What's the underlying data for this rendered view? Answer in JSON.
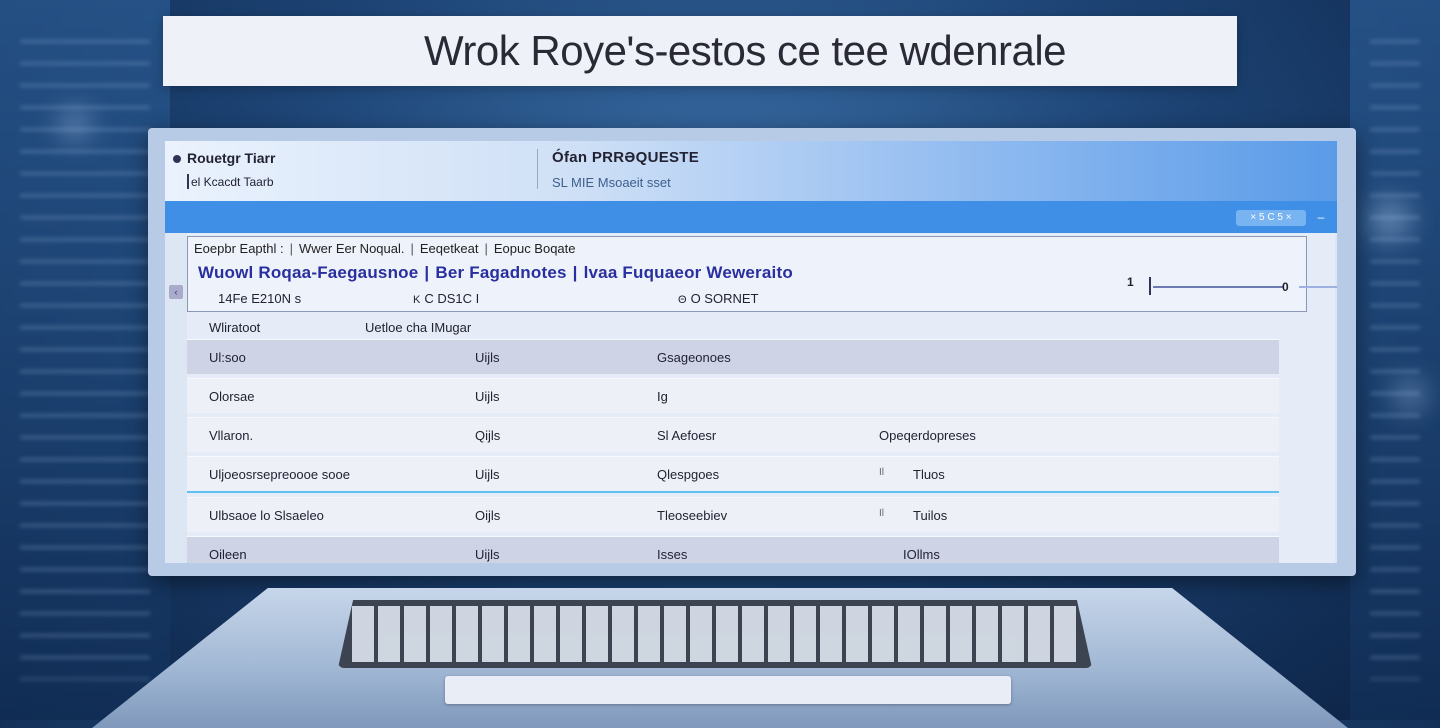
{
  "banner": {
    "title": "Wrok Roye's-estos ce tee wdenrale"
  },
  "app": {
    "title": "Rouetgr Tiarr",
    "subtitle": "el Kcacdt Taarb"
  },
  "request": {
    "title": "Ófan PRRƏQUESTE",
    "subtitle": "SL MIE Msoaeit sset"
  },
  "toolbar": {
    "pill": "× 5 C 5 ×",
    "min_label": "–"
  },
  "filters": {
    "links": [
      "Eoepbr Eapthl :",
      "Wwer Eer Noqual.",
      "Eeqetkeat",
      "Eopuc Boqate"
    ],
    "main": [
      "Wuowl Roqaa-Faegausnoe",
      "Ber Fagadnotes",
      "lvaa Fuquaeor Weweraito"
    ],
    "date": "14Fe E210N s",
    "mid": "C DS1C I",
    "right": "O SORNET",
    "mid_icon": "K",
    "right_icon": "Θ"
  },
  "slider": {
    "min_label": "1",
    "thumb_label": "0"
  },
  "table": {
    "headers": [
      "Wliratoot",
      "Uetloe cha IMugar"
    ],
    "rows": [
      {
        "col1": "Ul:soo",
        "col2": "Uijls",
        "col3": "Gsageonoes",
        "col4": "",
        "col5": ""
      },
      {
        "col1": "Olorsae",
        "col2": "Uijls",
        "col3": "Ig",
        "col4": "",
        "col5": ""
      },
      {
        "col1": "Vllaron.",
        "col2": "Qijls",
        "col3": "Sl Aefoesr",
        "col4": "",
        "col5": "Opeqerdopreses"
      },
      {
        "col1": "Uljoeosrsepreoooe sooe",
        "col2": "Uijls",
        "col3": "Qlespgoes",
        "col4": "Il",
        "col5": "Tluos"
      },
      {
        "col1": "Ulbsaoe lo Slsaeleo",
        "col2": "Oijls",
        "col3": "Tleoseebiev",
        "col4": "Il",
        "col5": "Tuilos"
      },
      {
        "col1": "Oileen",
        "col2": "Uijls",
        "col3": "Isses",
        "col4": "",
        "col5": "IOllms"
      }
    ]
  },
  "colors": {
    "accent": "#3f8fe6",
    "header_link": "#2a2fa0",
    "selected_row_border": "#5ec1f0"
  }
}
